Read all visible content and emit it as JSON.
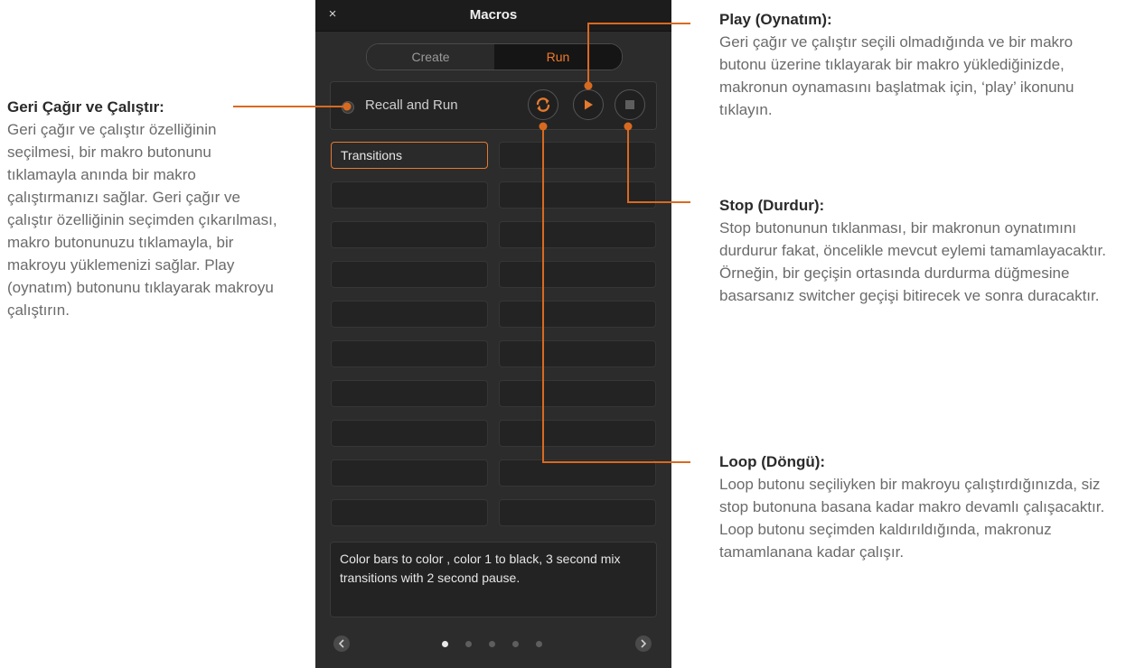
{
  "annotations": {
    "recall": {
      "title": "Geri Çağır ve Çalıştır:",
      "body": "Geri çağır ve çalıştır özelliğinin seçilmesi, bir makro butonunu tıklamayla anında bir makro çalıştırmanızı sağlar. Geri çağır ve çalıştır özelliğinin seçimden çıkarılması, makro butonunuzu tıklamayla, bir makroyu yüklemenizi sağlar. Play (oynatım) butonunu tıklayarak makroyu çalıştırın."
    },
    "play": {
      "title": "Play (Oynatım):",
      "body": "Geri çağır ve çalıştır seçili olmadığında ve bir makro butonu üzerine tıklayarak bir makro yüklediğinizde, makronun oynamasını başlatmak için, ‘play’ ikonunu tıklayın."
    },
    "stop": {
      "title": "Stop (Durdur):",
      "body": "Stop butonunun tıklanması, bir makronun oynatımını durdurur fakat, öncelikle mevcut eylemi tamamlayacaktır. Örneğin, bir geçişin ortasında durdurma düğmesine basarsanız switcher geçişi bitirecek ve sonra duracaktır."
    },
    "loop": {
      "title": "Loop (Döngü):",
      "body": "Loop butonu seçiliyken bir makroyu çalıştırdığınızda, siz stop butonuna basana kadar makro devamlı çalışacaktır. Loop butonu seçimden kaldırıldığında, makronuz tamamlanana kadar çalışır."
    }
  },
  "panel": {
    "close_label": "×",
    "title": "Macros",
    "tabs": {
      "create": "Create",
      "run": "Run",
      "active": "run"
    },
    "recall_and_run": {
      "label": "Recall and Run",
      "checked": false
    },
    "icons": {
      "loop": "loop-icon",
      "play": "play-icon",
      "stop": "stop-icon"
    },
    "macros": [
      "Transitions",
      "",
      "",
      "",
      "",
      "",
      "",
      "",
      "",
      "",
      "",
      "",
      "",
      "",
      "",
      "",
      "",
      "",
      "",
      ""
    ],
    "selected_macro": 0,
    "description": "Color bars to color , color 1 to black, 3 second mix transitions with 2 second pause.",
    "pagination": {
      "pages": 5,
      "current": 1
    }
  },
  "colors": {
    "accent": "#e47a2e",
    "callout_line": "#d86a20",
    "panel_bg": "#2c2c2c",
    "run_tab_text": "#f07a2c"
  }
}
